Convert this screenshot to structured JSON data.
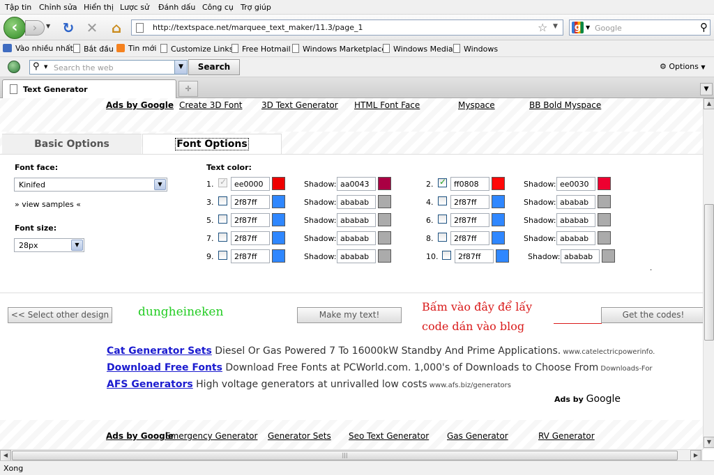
{
  "menu": [
    "Tập tin",
    "Chỉnh sửa",
    "Hiển thị",
    "Lược sử",
    "Đánh dấu",
    "Công cụ",
    "Trợ giúp"
  ],
  "nav": {
    "url": "http://textspace.net/marquee_text_maker/11.3/page_1",
    "search_placeholder": "Google"
  },
  "bookmarks": [
    "Vào nhiều nhất",
    "Bắt đầu",
    "Tin mới",
    "Customize Links",
    "Free Hotmail",
    "Windows Marketplace",
    "Windows Media",
    "Windows"
  ],
  "toolbar2": {
    "search_placeholder": "Search the web",
    "search_button": "Search",
    "options": "Options"
  },
  "tab": {
    "title": "Text Generator"
  },
  "ads_top": {
    "label": "Ads by Google",
    "links": [
      "Create 3D Font",
      "3D Text Generator",
      "HTML Font Face",
      "Myspace",
      "BB Bold Myspace"
    ]
  },
  "option_tabs": {
    "basic": "Basic Options",
    "font": "Font Options"
  },
  "font_options": {
    "font_face_label": "Font face:",
    "font_face_value": "Kinifed",
    "view_samples": "» view samples «",
    "font_size_label": "Font size:",
    "font_size_value": "28px",
    "text_color_label": "Text color:",
    "shadow_label": "Shadow:",
    "rows": [
      {
        "n": "1.",
        "checked": true,
        "disabled": true,
        "color": "ee0000",
        "swatch": "#ee0000",
        "shadow": "aa0043",
        "shadow_swatch": "#aa0043"
      },
      {
        "n": "2.",
        "checked": true,
        "disabled": false,
        "color": "ff0808",
        "swatch": "#ff0808",
        "shadow": "ee0030",
        "shadow_swatch": "#ee0030"
      },
      {
        "n": "3.",
        "checked": false,
        "disabled": false,
        "color": "2f87ff",
        "swatch": "#2f87ff",
        "shadow": "ababab",
        "shadow_swatch": "#ababab"
      },
      {
        "n": "4.",
        "checked": false,
        "disabled": false,
        "color": "2f87ff",
        "swatch": "#2f87ff",
        "shadow": "ababab",
        "shadow_swatch": "#ababab"
      },
      {
        "n": "5.",
        "checked": false,
        "disabled": false,
        "color": "2f87ff",
        "swatch": "#2f87ff",
        "shadow": "ababab",
        "shadow_swatch": "#ababab"
      },
      {
        "n": "6.",
        "checked": false,
        "disabled": false,
        "color": "2f87ff",
        "swatch": "#2f87ff",
        "shadow": "ababab",
        "shadow_swatch": "#ababab"
      },
      {
        "n": "7.",
        "checked": false,
        "disabled": false,
        "color": "2f87ff",
        "swatch": "#2f87ff",
        "shadow": "ababab",
        "shadow_swatch": "#ababab"
      },
      {
        "n": "8.",
        "checked": false,
        "disabled": false,
        "color": "2f87ff",
        "swatch": "#2f87ff",
        "shadow": "ababab",
        "shadow_swatch": "#ababab"
      },
      {
        "n": "9.",
        "checked": false,
        "disabled": false,
        "color": "2f87ff",
        "swatch": "#2f87ff",
        "shadow": "ababab",
        "shadow_swatch": "#ababab"
      },
      {
        "n": "10.",
        "checked": false,
        "disabled": false,
        "color": "2f87ff",
        "swatch": "#2f87ff",
        "shadow": "ababab",
        "shadow_swatch": "#ababab"
      }
    ]
  },
  "actions": {
    "select_other": "<< Select other design",
    "username": "dungheineken",
    "make_text": "Make my text!",
    "annotation_line1": "Bấm vào đây để lấy",
    "annotation_line2": "code dán vào blog",
    "get_codes": "Get the codes!"
  },
  "sponsored": [
    {
      "title": "Cat Generator Sets",
      "desc": " Diesel Or Gas Powered 7 To 16000kW Standby And Prime Applications.",
      "domain": " www.catelectricpowerinfo."
    },
    {
      "title": "Download Free Fonts",
      "desc": " Download Free Fonts at PCWorld.com. 1,000's of Downloads to Choose From",
      "domain": " Downloads-For"
    },
    {
      "title": "AFS Generators",
      "desc": " High voltage generators at unrivalled low costs",
      "domain": " www.afs.biz/generators"
    }
  ],
  "ads_by_google_badge": {
    "prefix": "Ads by ",
    "brand": "Google"
  },
  "ads_bottom": {
    "label": "Ads by Google",
    "links": [
      "Emergency Generator",
      "Generator Sets",
      "Seo Text Generator",
      "Gas Generator",
      "RV Generator"
    ]
  },
  "status": "Xong",
  "colors": {
    "annotation_red": "#d91a1a",
    "username_green": "#22cc22",
    "sponsor_link": "#1b1bcf"
  }
}
